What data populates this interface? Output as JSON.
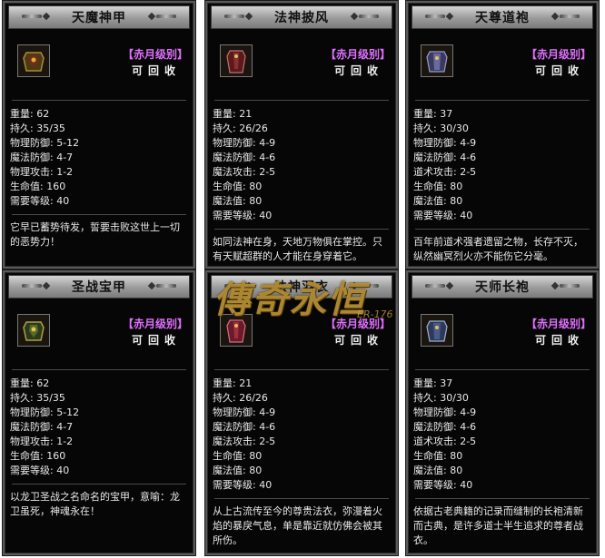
{
  "cards": [
    {
      "title": "天魔神甲",
      "grade": "【赤月级别】",
      "recycle": "可回收",
      "stats": [
        "重量: 62",
        "持久: 35/35",
        "物理防御: 5-12",
        "魔法防御: 4-7",
        "物理攻击: 1-2",
        "生命值: 160",
        "需要等级: 40"
      ],
      "desc": "它早已蓄势待发，誓要击败这世上一切的恶势力！",
      "icon": "dark-armor-icon"
    },
    {
      "title": "法神披风",
      "grade": "【赤月级别】",
      "recycle": "可回收",
      "stats": [
        "重量: 21",
        "持久: 26/26",
        "物理防御: 4-9",
        "魔法防御: 4-6",
        "魔法攻击: 2-5",
        "生命值: 80",
        "魔法值: 80",
        "需要等级: 40"
      ],
      "desc": "如同法神在身，天地万物俱在掌控。只有天赋超群的人才能在身穿着它。",
      "icon": "mage-robe-icon"
    },
    {
      "title": "天尊道袍",
      "grade": "【赤月级别】",
      "recycle": "可回收",
      "stats": [
        "重量: 37",
        "持久: 30/30",
        "物理防御: 4-9",
        "魔法防御: 4-6",
        "道术攻击: 2-5",
        "生命值: 80",
        "魔法值: 80",
        "需要等级: 40"
      ],
      "desc": "百年前道术强者遗留之物，长存不灭，纵然幽冥烈火亦不能伤它分毫。",
      "icon": "taoist-robe-icon"
    },
    {
      "title": "圣战宝甲",
      "grade": "【赤月级别】",
      "recycle": "可回收",
      "stats": [
        "重量: 62",
        "持久: 35/35",
        "物理防御: 5-12",
        "魔法防御: 4-7",
        "物理攻击: 1-2",
        "生命值: 160",
        "需要等级: 40"
      ],
      "desc": "以龙卫圣战之名命名的宝甲，意喻：龙卫虽死，神魂永在！",
      "icon": "holy-armor-icon"
    },
    {
      "title": "法神羽衣",
      "grade": "【赤月级别】",
      "recycle": "可回收",
      "stats": [
        "重量: 21",
        "持久: 26/26",
        "物理防御: 4-9",
        "魔法防御: 4-6",
        "魔法攻击: 2-5",
        "生命值: 80",
        "魔法值: 80",
        "需要等级: 40"
      ],
      "desc": "从上古流传至今的尊贵法衣，弥漫着火焰的暴戾气息，单是靠近就仿佛会被其所伤。",
      "icon": "feather-robe-icon"
    },
    {
      "title": "天师长袍",
      "grade": "【赤月级别】",
      "recycle": "可回收",
      "stats": [
        "重量: 37",
        "持久: 30/30",
        "物理防御: 4-9",
        "魔法防御: 4-6",
        "道术攻击: 2-5",
        "生命值: 80",
        "魔法值: 80",
        "需要等级: 40"
      ],
      "desc": "依据古老典籍的记录而缝制的长袍清新而古典，是许多道士半生追求的尊者战衣。",
      "icon": "master-robe-icon"
    }
  ],
  "watermark": {
    "text": "傳奇永恒",
    "sub": "ER-176"
  },
  "colors": {
    "grade": "#e070ff",
    "panel": "#060606",
    "header": "#b5b5b5"
  }
}
